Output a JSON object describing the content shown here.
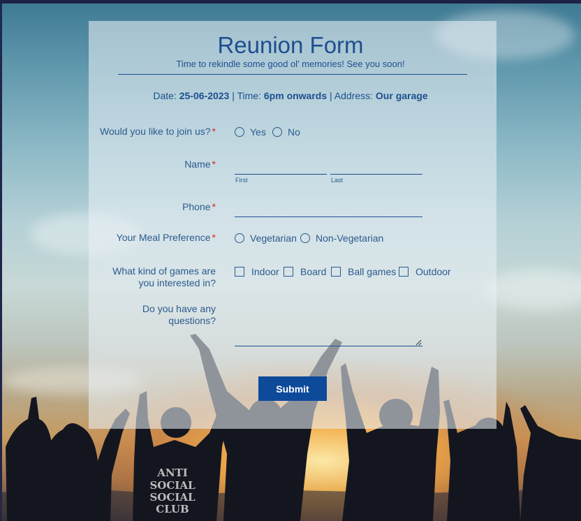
{
  "form": {
    "title": "Reunion Form",
    "subtitle": "Time to rekindle some good ol' memories! See you soon!",
    "info": {
      "date_label": "Date: ",
      "date_value": "25-06-2023",
      "sep1": "  |  Time: ",
      "time_value": "6pm onwards",
      "sep2": " | Address: ",
      "address_value": "Our garage"
    },
    "join": {
      "label": "Would you like to join us?",
      "required": "*",
      "options": [
        "Yes",
        "No"
      ]
    },
    "name": {
      "label": "Name",
      "required": "*",
      "first_sublabel": "First",
      "last_sublabel": "Last",
      "first_value": "",
      "last_value": ""
    },
    "phone": {
      "label": "Phone",
      "required": "*",
      "value": ""
    },
    "meal": {
      "label": "Your Meal Preference",
      "required": "*",
      "options": [
        "Vegetarian",
        "Non-Vegetarian"
      ]
    },
    "games": {
      "label_line1": "What kind of games are",
      "label_line2": "you interested in?",
      "options": [
        "Indoor",
        "Board",
        "Ball games",
        "Outdoor"
      ]
    },
    "questions": {
      "label_line1": "Do you have any",
      "label_line2": "questions?",
      "value": ""
    },
    "submit_label": "Submit"
  },
  "background": {
    "shirt_text": [
      "ANTI",
      "SOCIAL",
      "SOCIAL",
      "CLUB"
    ]
  },
  "colors": {
    "accent": "#1c4f8f",
    "button": "#0d4a9a",
    "required": "#dd2222"
  }
}
